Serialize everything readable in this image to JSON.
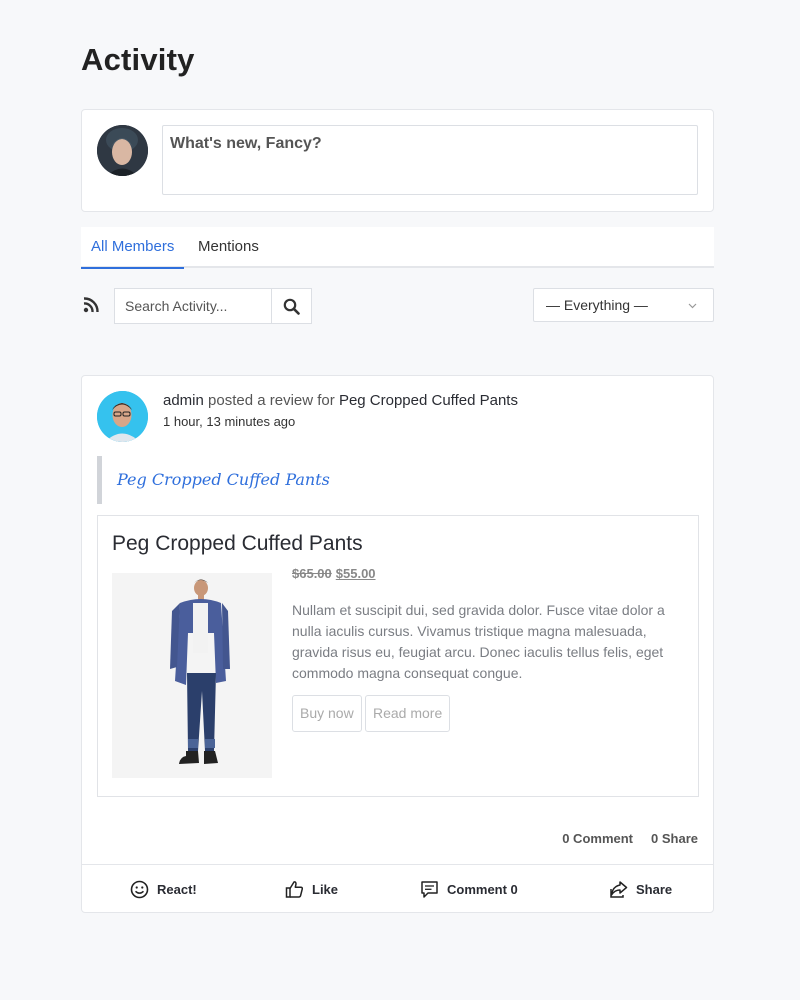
{
  "page": {
    "title": "Activity"
  },
  "post_box": {
    "placeholder": "What's new, Fancy?"
  },
  "tabs": [
    {
      "label": "All Members",
      "active": true
    },
    {
      "label": "Mentions",
      "active": false
    }
  ],
  "search": {
    "placeholder": "Search Activity..."
  },
  "filter": {
    "selected": "— Everything —"
  },
  "activity": {
    "user": "admin",
    "action_text": " posted a review for ",
    "product_link": "Peg Cropped Cuffed Pants",
    "time": "1 hour, 13 minutes ago",
    "quote": "Peg Cropped Cuffed Pants",
    "product": {
      "title": "Peg Cropped Cuffed Pants",
      "old_price": "$65.00",
      "new_price": "$55.00",
      "description": "Nullam et suscipit dui, sed gravida dolor. Fusce vitae dolor a nulla iaculis cursus. Vivamus tristique magna malesuada, gravida risus eu, feugiat arcu. Donec iaculis tellus felis, eget commodo magna consequat congue.",
      "buy_label": "Buy now",
      "read_label": "Read more"
    },
    "counts": {
      "comments": "0 Comment",
      "shares": "0 Share"
    },
    "actions": {
      "react": "React!",
      "like": "Like",
      "comment": "Comment 0",
      "share": "Share"
    }
  },
  "colors": {
    "accent": "#2f6fdc",
    "background": "#f7f8fa"
  },
  "icons": [
    "rss-icon",
    "search-icon",
    "chevron-down-icon",
    "smiley-icon",
    "thumbs-up-icon",
    "comment-icon",
    "share-icon"
  ]
}
